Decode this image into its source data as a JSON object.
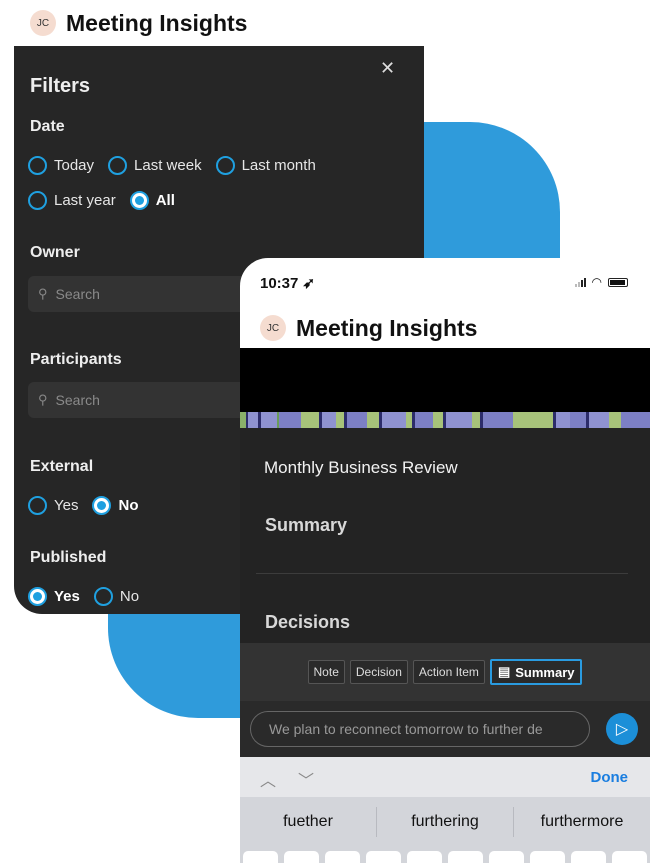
{
  "colors": {
    "accent": "#1fa0e0",
    "blob": "#2f9bdb",
    "done": "#1a7ee0"
  },
  "back": {
    "avatar": "JC",
    "app_title": "Meeting Insights",
    "filters": {
      "title": "Filters",
      "close_icon": "close-icon",
      "date": {
        "title": "Date",
        "options": [
          {
            "label": "Today",
            "selected": false
          },
          {
            "label": "Last week",
            "selected": false
          },
          {
            "label": "Last month",
            "selected": false
          },
          {
            "label": "Last year",
            "selected": false
          },
          {
            "label": "All",
            "selected": true
          }
        ]
      },
      "owner": {
        "title": "Owner",
        "placeholder": "Search"
      },
      "participants": {
        "title": "Participants",
        "placeholder": "Search"
      },
      "external": {
        "title": "External",
        "options": [
          {
            "label": "Yes",
            "selected": false
          },
          {
            "label": "No",
            "selected": true
          }
        ]
      },
      "published": {
        "title": "Published",
        "options": [
          {
            "label": "Yes",
            "selected": true
          },
          {
            "label": "No",
            "selected": false
          }
        ]
      }
    }
  },
  "phone": {
    "time": "10:37",
    "avatar": "JC",
    "app_title": "Meeting Insights",
    "meeting_name": "Monthly Business Review",
    "summary_heading": "Summary",
    "decisions_heading": "Decisions",
    "chips": {
      "note": "Note",
      "decision": "Decision",
      "action_item": "Action Item",
      "summary": "Summary"
    },
    "composer_value": "We plan to reconnect tomorrow to further de",
    "keyboard": {
      "done": "Done",
      "suggestions": [
        "fuether",
        "furthering",
        "furthermore"
      ]
    }
  }
}
